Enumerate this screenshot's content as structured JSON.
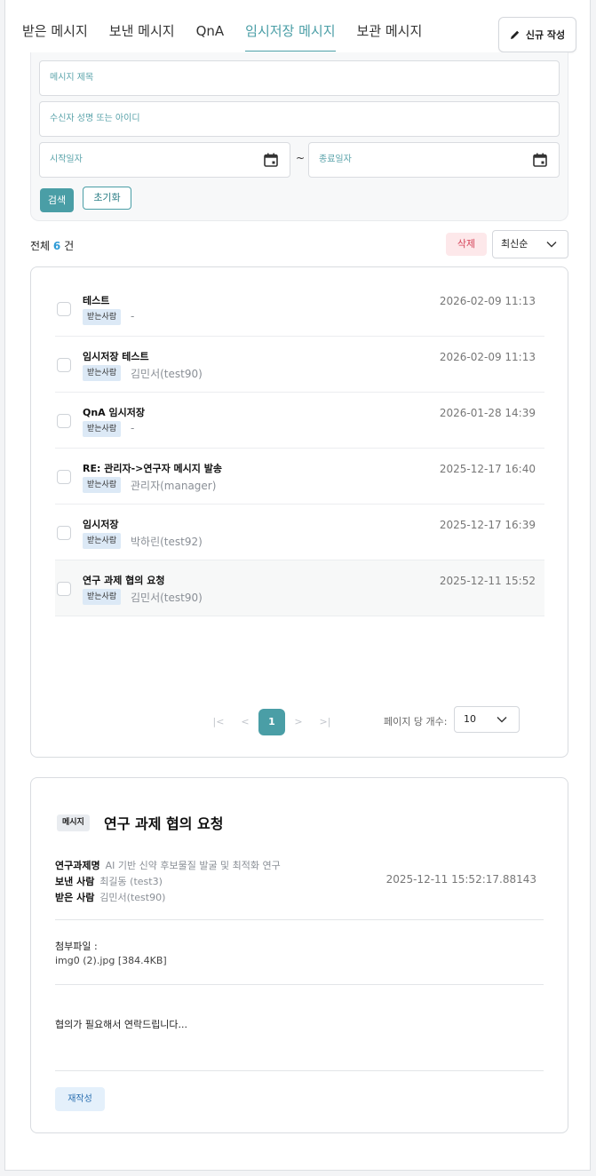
{
  "tabs": [
    "받은 메시지",
    "보낸 메시지",
    "QnA",
    "임시저장 메시지",
    "보관 메시지"
  ],
  "active_tab": "임시저장 메시지",
  "new_button": {
    "label": "신규 작성",
    "icon": "pencil-icon"
  },
  "filter": {
    "title_placeholder": "메시지 제목",
    "recipient_placeholder": "수신자 성명 또는 아이디",
    "start_placeholder": "시작일자",
    "separator": "~",
    "end_placeholder": "종료일자",
    "search_label": "검색",
    "reset_label": "초기화"
  },
  "summary": {
    "prefix": "전체",
    "count": "6",
    "suffix": "건"
  },
  "delete_label": "삭제",
  "sort": {
    "selected": "최신순"
  },
  "list": [
    {
      "title": "테스트",
      "badge": "받는사람",
      "recipient": "-",
      "date": "2026-02-09 11:13",
      "selected": false
    },
    {
      "title": "임시저장 테스트",
      "badge": "받는사람",
      "recipient": "김민서(test90)",
      "date": "2026-02-09 11:13",
      "selected": false
    },
    {
      "title": "QnA 임시저장",
      "badge": "받는사람",
      "recipient": "-",
      "date": "2026-01-28 14:39",
      "selected": false
    },
    {
      "title": "RE: 관리자->연구자 메시지 발송",
      "badge": "받는사람",
      "recipient": "관리자(manager)",
      "date": "2025-12-17 16:40",
      "selected": false
    },
    {
      "title": "임시저장",
      "badge": "받는사람",
      "recipient": "박하린(test92)",
      "date": "2025-12-17 16:39",
      "selected": false
    },
    {
      "title": "연구 과제 협의 요청",
      "badge": "받는사람",
      "recipient": "김민서(test90)",
      "date": "2025-12-11 15:52",
      "selected": true
    }
  ],
  "pagination": {
    "first": "|<",
    "prev": "<",
    "current": "1",
    "next": ">",
    "last": ">|",
    "per_page_label": "페이지 당 개수:",
    "per_page": "10"
  },
  "detail": {
    "badge": "메시지",
    "title": "연구 과제 협의 요청",
    "project_label": "연구과제명",
    "project": "AI 기반 신약 후보물질 발굴 및 최적화 연구",
    "sender_label": "보낸 사람",
    "sender": "최길동 (test3)",
    "recipient_label": "받은 사람",
    "recipient": "김민서(test90)",
    "datetime": "2025-12-11 15:52:17.88143",
    "attachment_label": "첨부파일 :",
    "attachment": "img0 (2).jpg [384.4KB]",
    "body": "협의가 필요해서 연락드립니다...",
    "rewrite_label": "재작성"
  },
  "colors": {
    "accent": "#4a9ea6",
    "count": "#2f9bd6",
    "delete_bg": "#fde8ea",
    "delete_text": "#d6455a"
  }
}
